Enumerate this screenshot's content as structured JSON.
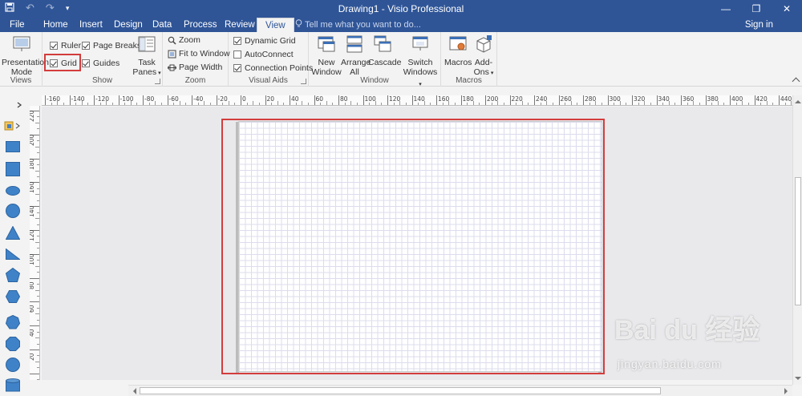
{
  "window": {
    "title": "Drawing1 - Visio Professional",
    "controls": [
      "minimize-icon",
      "restore-icon",
      "close-icon"
    ]
  },
  "quick_access": [
    "save-icon",
    "undo-icon",
    "redo-icon",
    "customize-qat-icon"
  ],
  "tabs": [
    "File",
    "Home",
    "Insert",
    "Design",
    "Data",
    "Process",
    "Review",
    "View"
  ],
  "active_tab": "View",
  "tell_me": "Tell me what you want to do...",
  "sign_in": "Sign in",
  "ribbon": {
    "views": {
      "label": "Views",
      "presentation_mode_line1": "Presentation",
      "presentation_mode_line2": "Mode"
    },
    "show": {
      "label": "Show",
      "ruler": "Ruler",
      "page_breaks": "Page Breaks",
      "grid": "Grid",
      "guides": "Guides",
      "task_panes_line1": "Task",
      "task_panes_line2": "Panes",
      "ruler_checked": true,
      "page_breaks_checked": true,
      "grid_checked": true,
      "guides_checked": true
    },
    "zoom": {
      "label": "Zoom",
      "zoom": "Zoom",
      "fit_to_window": "Fit to Window",
      "page_width": "Page Width"
    },
    "visual_aids": {
      "label": "Visual Aids",
      "dynamic_grid": "Dynamic Grid",
      "autoconnect": "AutoConnect",
      "connection_points": "Connection Points",
      "dynamic_grid_checked": true,
      "autoconnect_checked": false,
      "connection_points_checked": true
    },
    "window": {
      "label": "Window",
      "new_window_line1": "New",
      "new_window_line2": "Window",
      "arrange_all_line1": "Arrange",
      "arrange_all_line2": "All",
      "cascade": "Cascade",
      "switch_windows_line1": "Switch",
      "switch_windows_line2": "Windows"
    },
    "macros": {
      "label": "Macros",
      "macros": "Macros",
      "add_ons_line1": "Add-",
      "add_ons_line2": "Ons"
    }
  },
  "ruler_h": [
    "-160",
    "-140",
    "-120",
    "-100",
    "-80",
    "-60",
    "-40",
    "-20",
    "0",
    "20",
    "40",
    "60",
    "80",
    "100",
    "120",
    "140",
    "160",
    "180",
    "200",
    "220",
    "240",
    "260",
    "280",
    "300",
    "320",
    "340",
    "360",
    "380",
    "400",
    "420",
    "440"
  ],
  "ruler_v": [
    "220",
    "200",
    "180",
    "160",
    "140",
    "120",
    "100",
    "80",
    "60",
    "40",
    "20",
    "0"
  ],
  "watermark": {
    "main": "Bai du 经验",
    "sub": "jingyan.baidu.com"
  }
}
